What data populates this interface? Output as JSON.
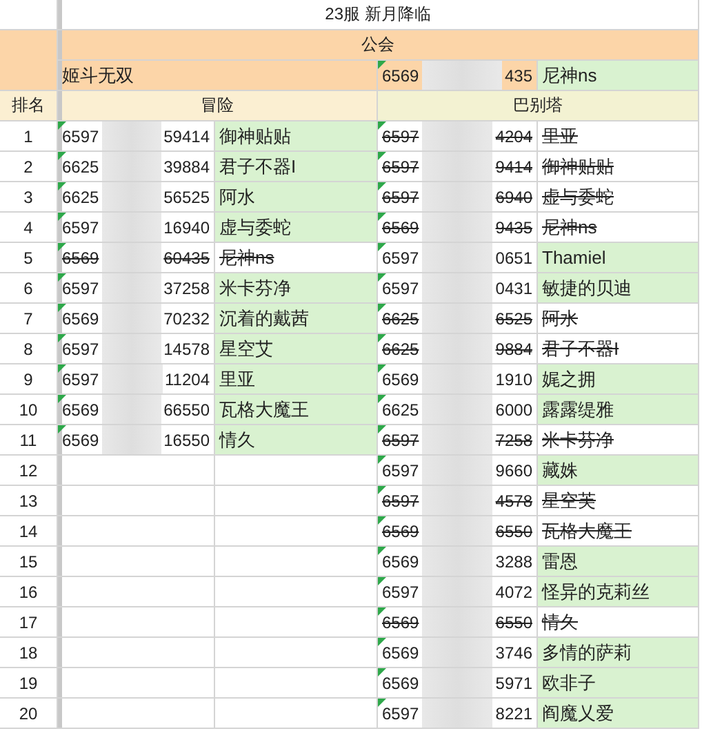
{
  "title": "23服 新月降临",
  "guild_header": "公会",
  "guild": {
    "name": "姬斗无双",
    "id_start": "6569",
    "id_end": "435",
    "member": "尼神ns"
  },
  "headers": {
    "rank": "排名",
    "adventure": "冒险",
    "babel": "巴别塔"
  },
  "rows": [
    {
      "rank": "1",
      "left": {
        "id_start": "6597",
        "id_end": "59414",
        "name": "御神贴贴",
        "struck": false,
        "highlighted": true
      },
      "right": {
        "id_start": "6597",
        "id_end": "4204",
        "name": "里亚",
        "struck": true,
        "highlighted": false
      }
    },
    {
      "rank": "2",
      "left": {
        "id_start": "6625",
        "id_end": "39884",
        "name": "君子不器I",
        "struck": false,
        "highlighted": true
      },
      "right": {
        "id_start": "6597",
        "id_end": "9414",
        "name": "御神贴贴",
        "struck": true,
        "highlighted": false
      }
    },
    {
      "rank": "3",
      "left": {
        "id_start": "6625",
        "id_end": "56525",
        "name": "阿水",
        "struck": false,
        "highlighted": true
      },
      "right": {
        "id_start": "6597",
        "id_end": "6940",
        "name": "虚与委蛇",
        "struck": true,
        "highlighted": false
      }
    },
    {
      "rank": "4",
      "left": {
        "id_start": "6597",
        "id_end": "16940",
        "name": "虚与委蛇",
        "struck": false,
        "highlighted": true
      },
      "right": {
        "id_start": "6569",
        "id_end": "9435",
        "name": "尼神ns",
        "struck": true,
        "highlighted": false
      }
    },
    {
      "rank": "5",
      "left": {
        "id_start": "6569",
        "id_end": "60435",
        "name": "尼神ns",
        "struck": true,
        "highlighted": false
      },
      "right": {
        "id_start": "6597",
        "id_end": "0651",
        "name": "Thamiel",
        "struck": false,
        "highlighted": true
      }
    },
    {
      "rank": "6",
      "left": {
        "id_start": "6597",
        "id_end": "37258",
        "name": "米卡芬净",
        "struck": false,
        "highlighted": true
      },
      "right": {
        "id_start": "6597",
        "id_end": "0431",
        "name": "敏捷的贝迪",
        "struck": false,
        "highlighted": true
      }
    },
    {
      "rank": "7",
      "left": {
        "id_start": "6569",
        "id_end": "70232",
        "name": "沉着的戴茜",
        "struck": false,
        "highlighted": true
      },
      "right": {
        "id_start": "6625",
        "id_end": "6525",
        "name": "阿水",
        "struck": true,
        "highlighted": false
      }
    },
    {
      "rank": "8",
      "left": {
        "id_start": "6597",
        "id_end": "14578",
        "name": "星空艾",
        "struck": false,
        "highlighted": true
      },
      "right": {
        "id_start": "6625",
        "id_end": "9884",
        "name": "君子不器I",
        "struck": true,
        "highlighted": false
      }
    },
    {
      "rank": "9",
      "left": {
        "id_start": "6597",
        "id_end": "11204",
        "name": "里亚",
        "struck": false,
        "highlighted": true
      },
      "right": {
        "id_start": "6569",
        "id_end": "1910",
        "name": "娓之拥",
        "struck": false,
        "highlighted": true
      }
    },
    {
      "rank": "10",
      "left": {
        "id_start": "6569",
        "id_end": "66550",
        "name": "瓦格大魔王",
        "struck": false,
        "highlighted": true
      },
      "right": {
        "id_start": "6625",
        "id_end": "6000",
        "name": "露露缇雅",
        "struck": false,
        "highlighted": true
      }
    },
    {
      "rank": "11",
      "left": {
        "id_start": "6569",
        "id_end": "16550",
        "name": "情久",
        "struck": false,
        "highlighted": true
      },
      "right": {
        "id_start": "6597",
        "id_end": "7258",
        "name": "米卡芬净",
        "struck": true,
        "highlighted": false
      }
    },
    {
      "rank": "12",
      "right": {
        "id_start": "6597",
        "id_end": "9660",
        "name": "藏姝",
        "struck": false,
        "highlighted": true
      }
    },
    {
      "rank": "13",
      "right": {
        "id_start": "6597",
        "id_end": "4578",
        "name": "星空芙",
        "struck": true,
        "highlighted": false
      }
    },
    {
      "rank": "14",
      "right": {
        "id_start": "6569",
        "id_end": "6550",
        "name": "瓦格大魔王",
        "struck": true,
        "highlighted": false
      }
    },
    {
      "rank": "15",
      "right": {
        "id_start": "6569",
        "id_end": "3288",
        "name": "雷恩",
        "struck": false,
        "highlighted": true
      }
    },
    {
      "rank": "16",
      "right": {
        "id_start": "6597",
        "id_end": "4072",
        "name": "怪异的克莉丝",
        "struck": false,
        "highlighted": true
      }
    },
    {
      "rank": "17",
      "right": {
        "id_start": "6569",
        "id_end": "6550",
        "name": "情久",
        "struck": true,
        "highlighted": false
      }
    },
    {
      "rank": "18",
      "right": {
        "id_start": "6569",
        "id_end": "3746",
        "name": "多情的萨莉",
        "struck": false,
        "highlighted": true
      }
    },
    {
      "rank": "19",
      "right": {
        "id_start": "6569",
        "id_end": "5971",
        "name": "欧非子",
        "struck": false,
        "highlighted": true
      }
    },
    {
      "rank": "20",
      "right": {
        "id_start": "6597",
        "id_end": "8221",
        "name": "阎魔乂爱",
        "struck": false,
        "highlighted": true
      }
    }
  ]
}
